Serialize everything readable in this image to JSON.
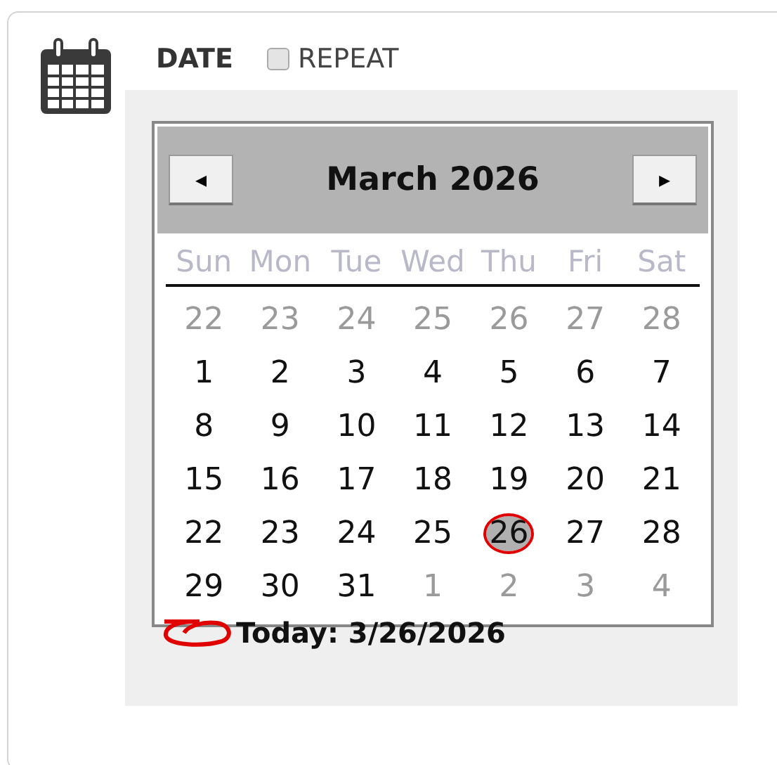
{
  "label": "DATE",
  "repeat": {
    "label": "REPEAT",
    "checked": false
  },
  "calendar": {
    "title": "March 2026",
    "prev": "◂",
    "next": "▸",
    "weekdays": [
      "Sun",
      "Mon",
      "Tue",
      "Wed",
      "Thu",
      "Fri",
      "Sat"
    ],
    "weeks": [
      [
        {
          "day": "22",
          "other": true,
          "selected": false
        },
        {
          "day": "23",
          "other": true,
          "selected": false
        },
        {
          "day": "24",
          "other": true,
          "selected": false
        },
        {
          "day": "25",
          "other": true,
          "selected": false
        },
        {
          "day": "26",
          "other": true,
          "selected": false
        },
        {
          "day": "27",
          "other": true,
          "selected": false
        },
        {
          "day": "28",
          "other": true,
          "selected": false
        }
      ],
      [
        {
          "day": "1",
          "other": false,
          "selected": false
        },
        {
          "day": "2",
          "other": false,
          "selected": false
        },
        {
          "day": "3",
          "other": false,
          "selected": false
        },
        {
          "day": "4",
          "other": false,
          "selected": false
        },
        {
          "day": "5",
          "other": false,
          "selected": false
        },
        {
          "day": "6",
          "other": false,
          "selected": false
        },
        {
          "day": "7",
          "other": false,
          "selected": false
        }
      ],
      [
        {
          "day": "8",
          "other": false,
          "selected": false
        },
        {
          "day": "9",
          "other": false,
          "selected": false
        },
        {
          "day": "10",
          "other": false,
          "selected": false
        },
        {
          "day": "11",
          "other": false,
          "selected": false
        },
        {
          "day": "12",
          "other": false,
          "selected": false
        },
        {
          "day": "13",
          "other": false,
          "selected": false
        },
        {
          "day": "14",
          "other": false,
          "selected": false
        }
      ],
      [
        {
          "day": "15",
          "other": false,
          "selected": false
        },
        {
          "day": "16",
          "other": false,
          "selected": false
        },
        {
          "day": "17",
          "other": false,
          "selected": false
        },
        {
          "day": "18",
          "other": false,
          "selected": false
        },
        {
          "day": "19",
          "other": false,
          "selected": false
        },
        {
          "day": "20",
          "other": false,
          "selected": false
        },
        {
          "day": "21",
          "other": false,
          "selected": false
        }
      ],
      [
        {
          "day": "22",
          "other": false,
          "selected": false
        },
        {
          "day": "23",
          "other": false,
          "selected": false
        },
        {
          "day": "24",
          "other": false,
          "selected": false
        },
        {
          "day": "25",
          "other": false,
          "selected": false
        },
        {
          "day": "26",
          "other": false,
          "selected": true
        },
        {
          "day": "27",
          "other": false,
          "selected": false
        },
        {
          "day": "28",
          "other": false,
          "selected": false
        }
      ],
      [
        {
          "day": "29",
          "other": false,
          "selected": false
        },
        {
          "day": "30",
          "other": false,
          "selected": false
        },
        {
          "day": "31",
          "other": false,
          "selected": false
        },
        {
          "day": "1",
          "other": true,
          "selected": false
        },
        {
          "day": "2",
          "other": true,
          "selected": false
        },
        {
          "day": "3",
          "other": true,
          "selected": false
        },
        {
          "day": "4",
          "other": true,
          "selected": false
        }
      ]
    ],
    "today": "Today: 3/26/2026"
  }
}
